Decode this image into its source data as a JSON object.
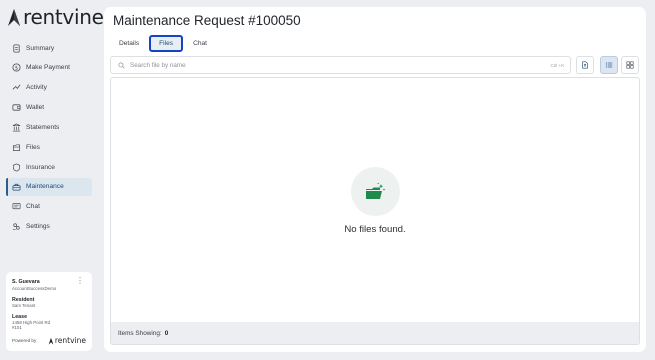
{
  "brand": {
    "logo_text": "rentvine",
    "color": "#1f2228"
  },
  "sidebar": {
    "items": [
      {
        "label": "Summary",
        "icon": "document-icon"
      },
      {
        "label": "Make Payment",
        "icon": "dollar-icon"
      },
      {
        "label": "Activity",
        "icon": "activity-icon"
      },
      {
        "label": "Wallet",
        "icon": "wallet-icon"
      },
      {
        "label": "Statements",
        "icon": "bank-icon"
      },
      {
        "label": "Files",
        "icon": "files-icon"
      },
      {
        "label": "Insurance",
        "icon": "shield-icon"
      },
      {
        "label": "Maintenance",
        "icon": "maintenance-icon",
        "active": true
      },
      {
        "label": "Chat",
        "icon": "chat-icon"
      },
      {
        "label": "Settings",
        "icon": "settings-icon"
      }
    ]
  },
  "user_card": {
    "name": "S. Guevara",
    "account": "AccountSuccessDemo",
    "role_label": "Resident",
    "role_value": "Sam Tenant",
    "lease_label": "Lease",
    "lease_line1": "1458 High Point Rd",
    "lease_line2": "#101",
    "powered_by": "Powered by",
    "powered_logo": "rentvine"
  },
  "main": {
    "title": "Maintenance Request #100050",
    "tabs": [
      {
        "label": "Details",
        "active": false
      },
      {
        "label": "Files",
        "active": true
      },
      {
        "label": "Chat",
        "active": false
      }
    ],
    "search": {
      "placeholder": "Search file by name",
      "shortcut": "Ctrl +K"
    },
    "buttons": {
      "upload": "upload-file-icon",
      "list_view": "list-view-icon",
      "grid_view": "grid-view-icon"
    },
    "empty_state": {
      "text": "No files found.",
      "icon": "open-folder-icon"
    },
    "footer": {
      "label": "Items Showing:",
      "count": "0"
    }
  },
  "colors": {
    "accent": "#1445c6",
    "active_nav_bg": "#dbe6ef",
    "active_nav_text": "#1d4a73",
    "folder_green": "#1f8a4c",
    "page_bg": "#eceef1"
  }
}
